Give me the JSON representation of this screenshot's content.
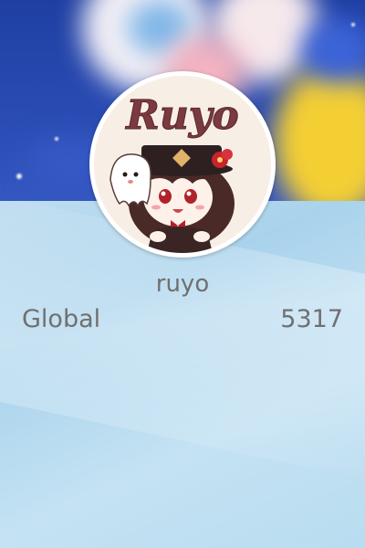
{
  "profile": {
    "username": "ruyo",
    "avatar_text": "Ruyo",
    "rank_label": "Global",
    "rank_value": "5317"
  },
  "colors": {
    "banner_blue": "#2a4cb4",
    "card_light_blue": "#c2dff0",
    "text_gray": "#707070",
    "avatar_logo_maroon": "#7a3a3f"
  }
}
